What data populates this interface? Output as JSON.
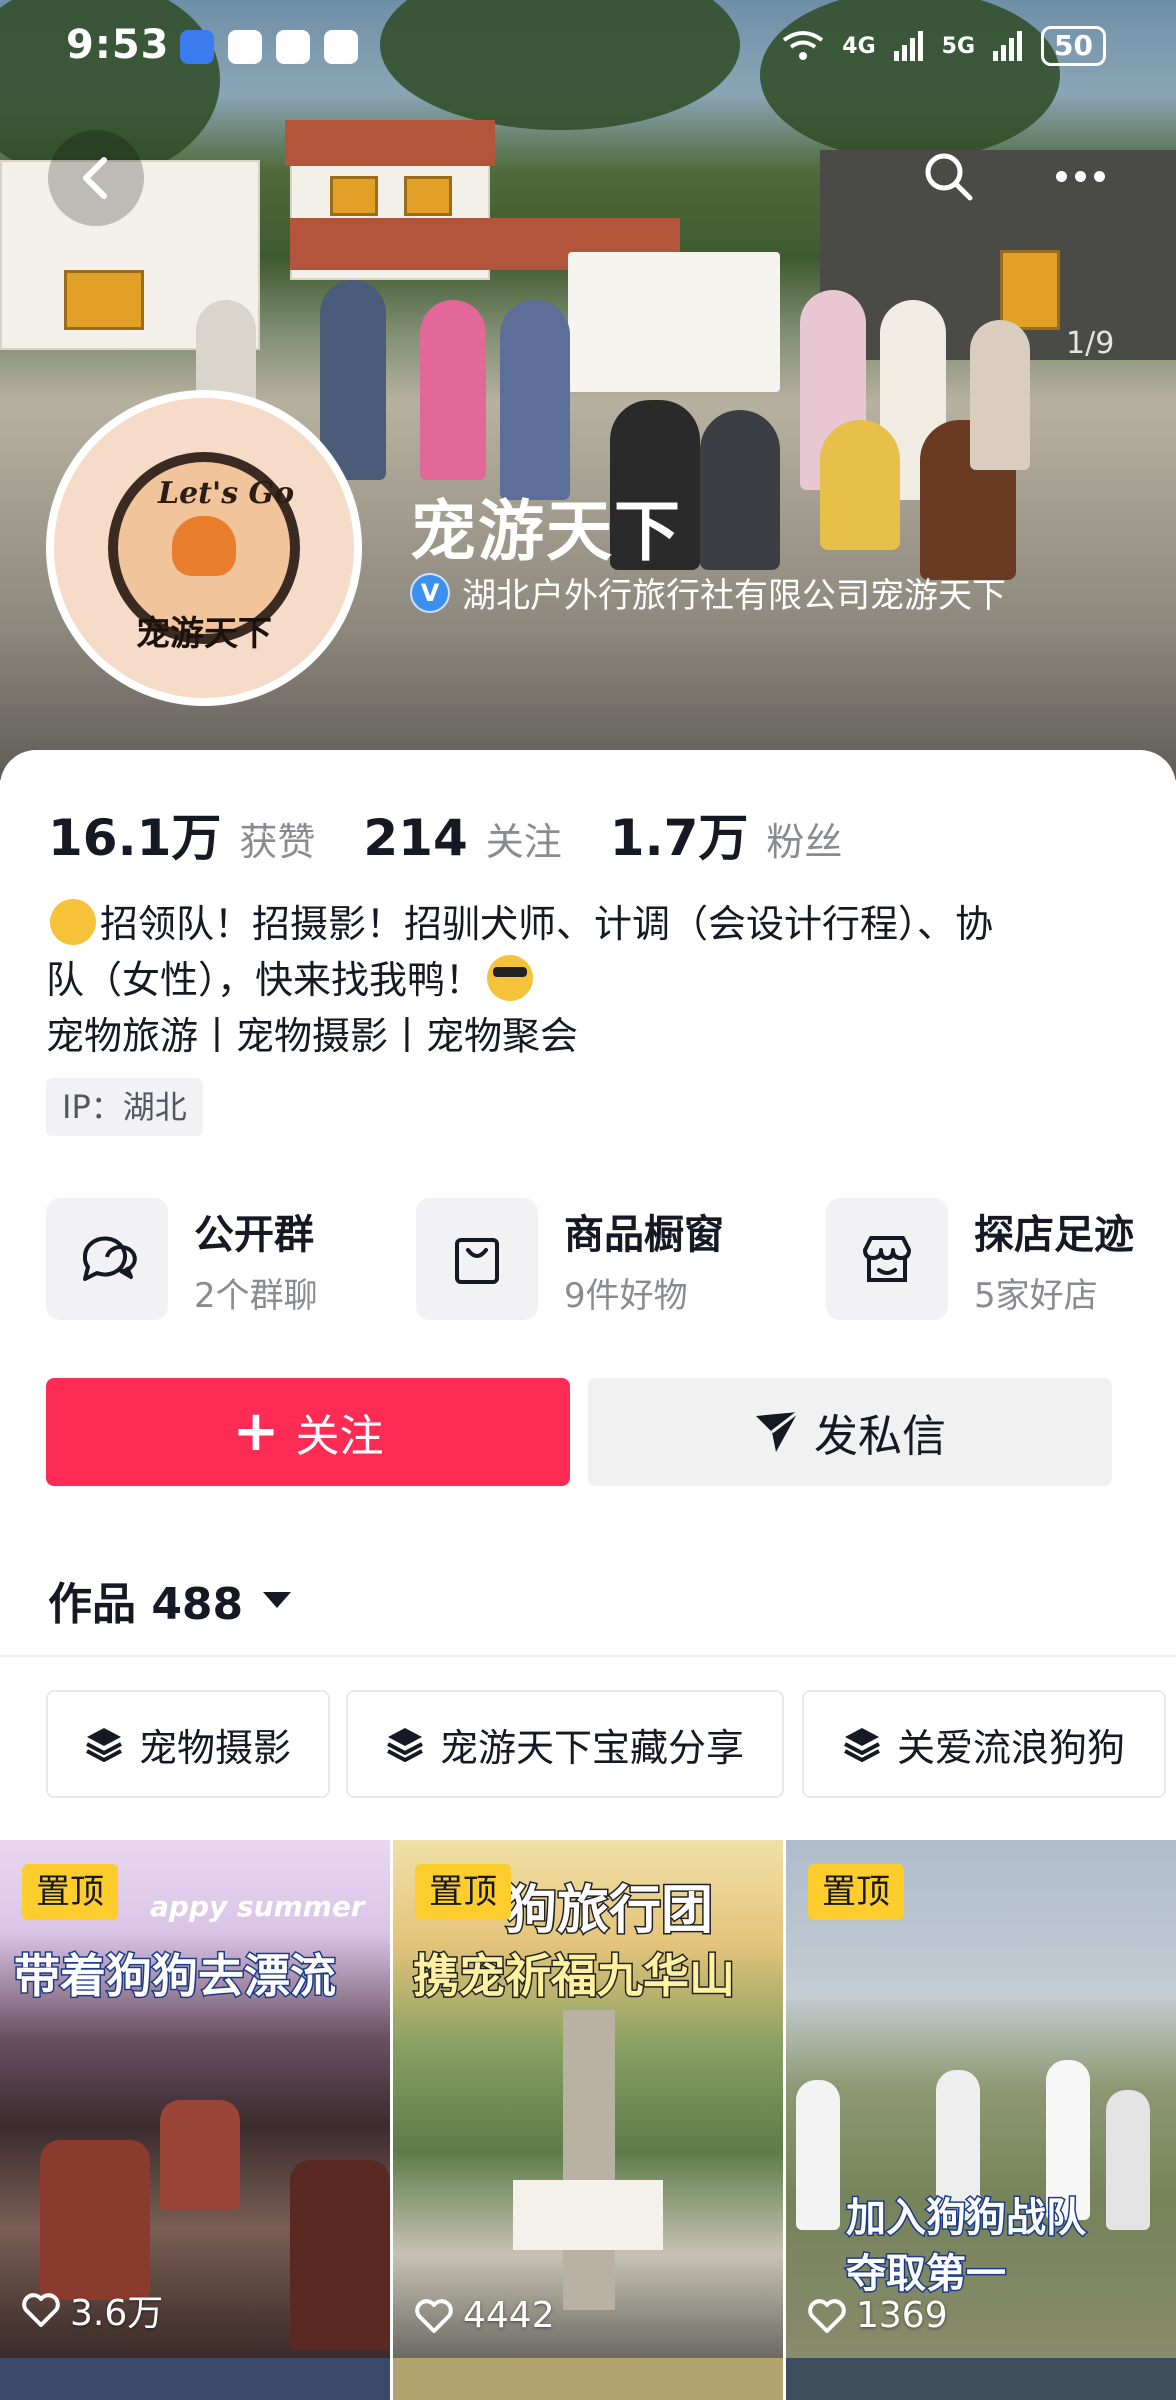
{
  "status_bar": {
    "time": "9:53",
    "network_1": "4G",
    "network_2": "5G",
    "battery": "50"
  },
  "hero": {
    "page_counter": "1/9",
    "profile_name": "宠游天下",
    "verified_org": "湖北户外行旅行社有限公司宠游天下",
    "avatar_lettering": "Let's Go 宠游天下"
  },
  "stats": [
    {
      "value": "16.1万",
      "label": "获赞"
    },
    {
      "value": "214",
      "label": "关注"
    },
    {
      "value": "1.7万",
      "label": "粉丝"
    }
  ],
  "bio": {
    "line1": "招领队！招摄影！招驯犬师、计调（会设计行程）、协",
    "line2": "队（女性），快来找我鸭！",
    "line3": "宠物旅游丨宠物摄影丨宠物聚会"
  },
  "ip": "IP：湖北",
  "features": [
    {
      "title": "公开群",
      "sub": "2个群聊",
      "icon": "chat-bubbles-icon"
    },
    {
      "title": "商品橱窗",
      "sub": "9件好物",
      "icon": "shopping-bag-icon"
    },
    {
      "title": "探店足迹",
      "sub": "5家好店",
      "icon": "store-icon"
    }
  ],
  "actions": {
    "follow": "关注",
    "message": "发私信"
  },
  "works": {
    "label": "作品 488"
  },
  "collections": [
    "宠物摄影",
    "宠游天下宝藏分享",
    "关爱流浪狗狗"
  ],
  "videos": [
    {
      "badge": "置顶",
      "headline": "带着狗狗去漂流",
      "sub": "appy summer",
      "likes": "3.6万"
    },
    {
      "badge": "置顶",
      "headline": "携宠祈福九华山",
      "sub": "狗旅行团",
      "likes": "4442"
    },
    {
      "badge": "置顶",
      "headline": "加入狗狗战队 夺取第一",
      "sub": "",
      "likes": "1369"
    }
  ],
  "colors": {
    "accent": "#fe2c55",
    "pin_badge": "#fccd2c",
    "verify": "#3d8ff0"
  }
}
